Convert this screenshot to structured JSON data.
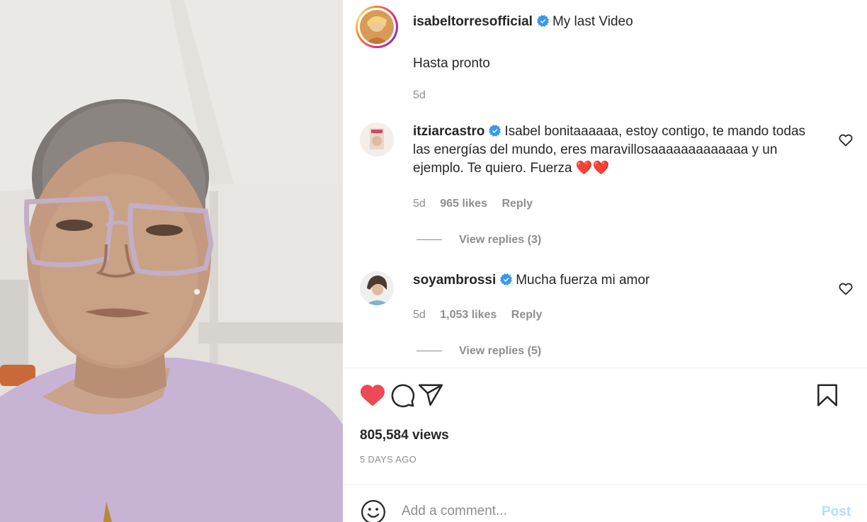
{
  "post": {
    "author": "isabeltorresofficial",
    "caption_title": "My last Video",
    "caption_body": "Hasta pronto",
    "caption_time": "5d",
    "verified_icon": "verified-badge-icon"
  },
  "comments": [
    {
      "username": "itziarcastro",
      "text": "Isabel bonitaaaaaa, estoy contigo, te mando todas las energías del mundo, eres maravillosaaaaaaaaaaaaa y un ejemplo. Te quiero. Fuerza ❤️❤️",
      "time": "5d",
      "likes": "965 likes",
      "reply_label": "Reply",
      "view_replies": "View replies (3)"
    },
    {
      "username": "soyambrossi",
      "text": "Mucha fuerza mi amor",
      "time": "5d",
      "likes": "1,053 likes",
      "reply_label": "Reply",
      "view_replies": "View replies (5)"
    }
  ],
  "actions": {
    "like_icon": "heart-filled-icon",
    "comment_icon": "comment-icon",
    "share_icon": "share-icon",
    "save_icon": "bookmark-icon",
    "liked_color": "#ed4956"
  },
  "stats": {
    "views": "805,584 views",
    "posted_ago": "5 DAYS AGO"
  },
  "add_comment": {
    "placeholder": "Add a comment...",
    "post_label": "Post"
  },
  "colors": {
    "text": "#262626",
    "secondary": "#8e8e8e",
    "post_disabled": "#b2dffc",
    "verified": "#3897f0"
  }
}
